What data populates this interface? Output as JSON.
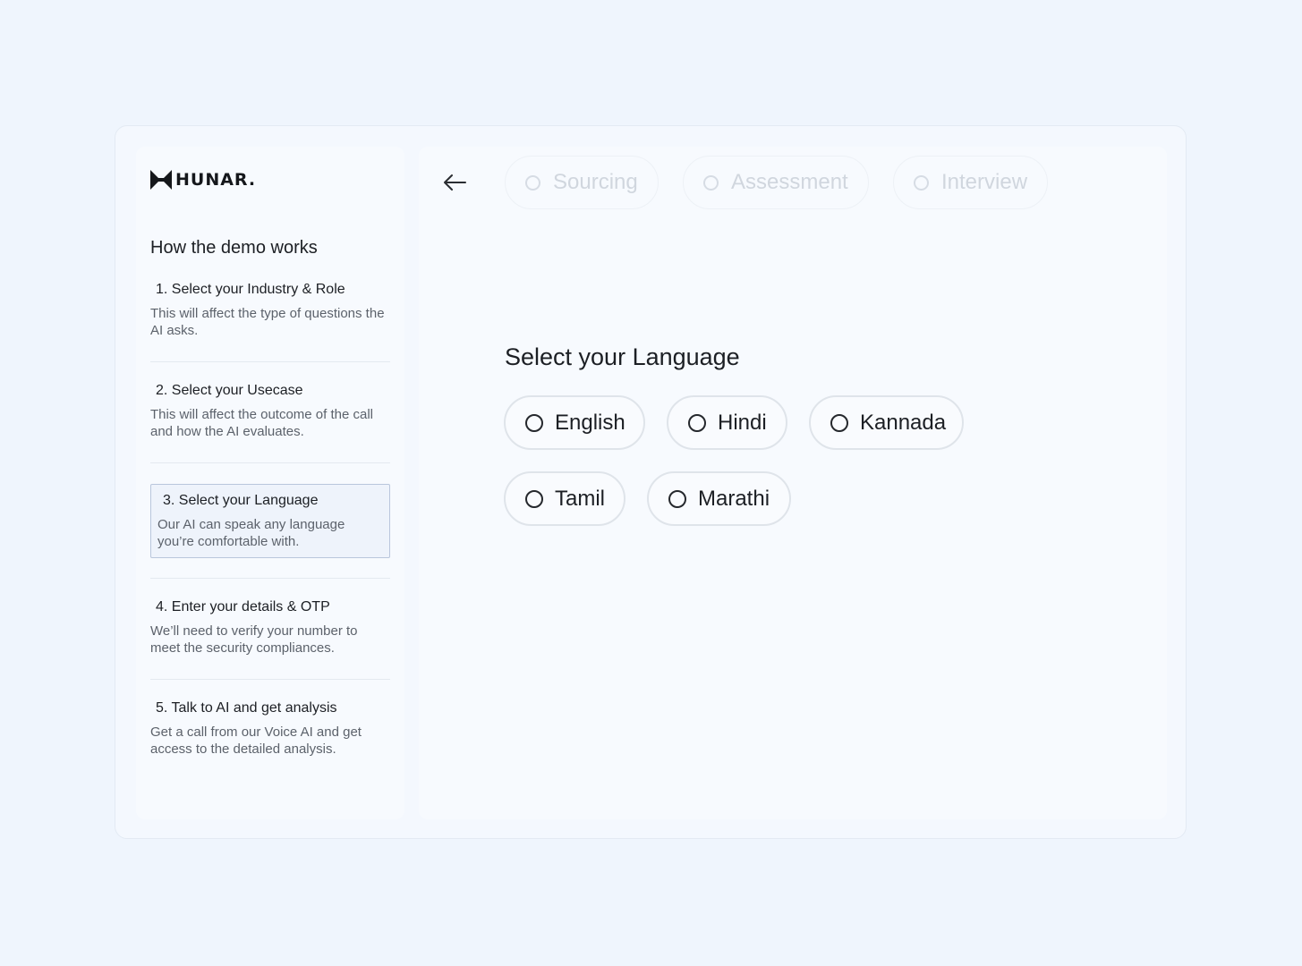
{
  "brand": {
    "name": "HUNAR."
  },
  "sidebar": {
    "title": "How the demo works",
    "steps": [
      {
        "title": "1. Select your Industry & Role",
        "description": "This will affect the type of questions the AI asks."
      },
      {
        "title": "2. Select your Usecase",
        "description": "This will affect the outcome of the call and how the AI evaluates."
      },
      {
        "title": "3. Select your Language",
        "description": "Our AI can speak any language you’re comfortable with.",
        "active": true
      },
      {
        "title": "4. Enter your details & OTP",
        "description": "We’ll need to verify your number to meet the security compliances."
      },
      {
        "title": "5. Talk to AI and get analysis",
        "description": "Get a call from our Voice AI and get access to the detailed analysis."
      }
    ]
  },
  "header": {
    "back_icon": "arrow-left-icon",
    "stages": [
      {
        "label": "Sourcing"
      },
      {
        "label": "Assessment"
      },
      {
        "label": "Interview"
      }
    ]
  },
  "language": {
    "title": "Select your Language",
    "options": [
      {
        "label": "English",
        "selected": false
      },
      {
        "label": "Hindi",
        "selected": false
      },
      {
        "label": "Kannada",
        "selected": false
      },
      {
        "label": "Tamil",
        "selected": false
      },
      {
        "label": "Marathi",
        "selected": false
      }
    ]
  },
  "colors": {
    "background": "#eff5fd",
    "panel": "#f7fafe",
    "active_step_border": "#b9c6dc",
    "disabled_text": "#d0d6de"
  }
}
